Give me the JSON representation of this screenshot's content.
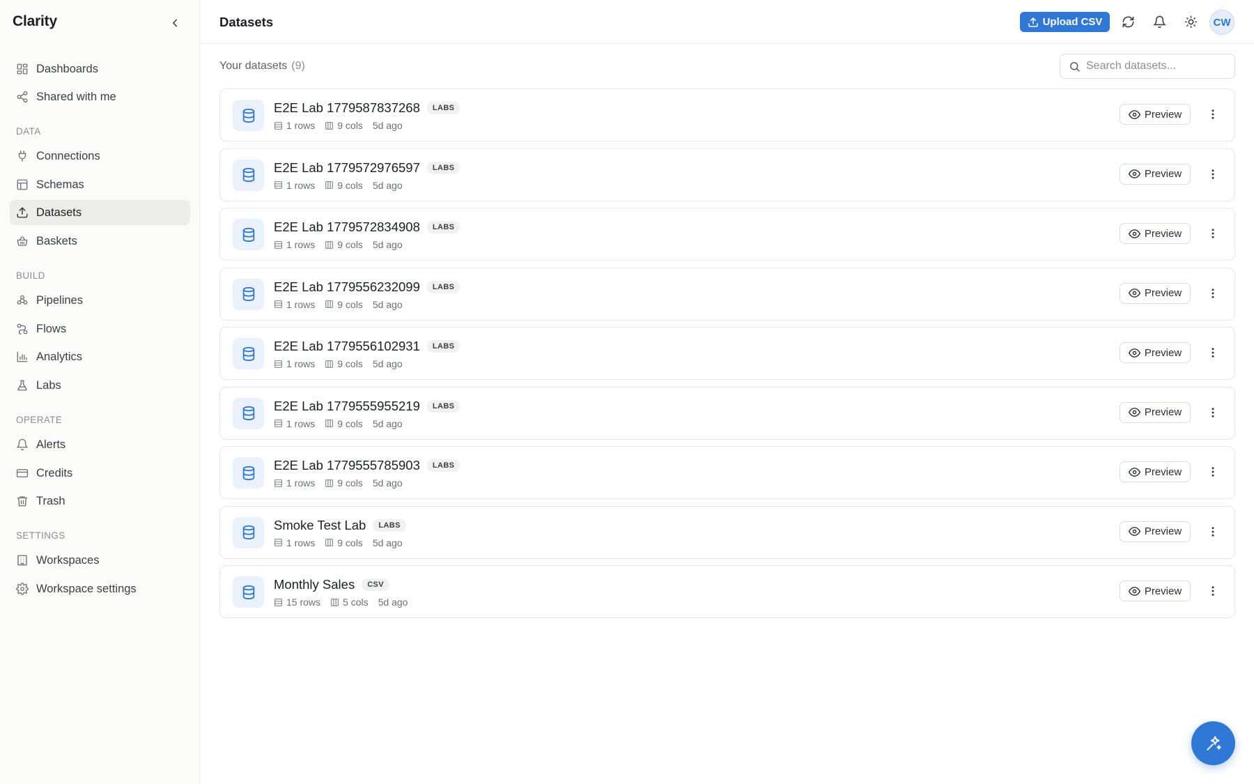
{
  "app": {
    "brand": "Clarity"
  },
  "sidebar": {
    "items_top": [
      {
        "label": "Dashboards",
        "icon": "dashboard-icon"
      },
      {
        "label": "Shared with me",
        "icon": "share-icon"
      }
    ],
    "sections": [
      {
        "label": "DATA",
        "items": [
          {
            "label": "Connections",
            "icon": "plug-icon"
          },
          {
            "label": "Schemas",
            "icon": "table-icon"
          },
          {
            "label": "Datasets",
            "icon": "upload-icon",
            "active": true
          },
          {
            "label": "Baskets",
            "icon": "basket-icon"
          }
        ]
      },
      {
        "label": "BUILD",
        "items": [
          {
            "label": "Pipelines",
            "icon": "pipelines-icon"
          },
          {
            "label": "Flows",
            "icon": "flows-icon"
          },
          {
            "label": "Analytics",
            "icon": "bar-chart-icon"
          },
          {
            "label": "Labs",
            "icon": "flask-icon"
          }
        ]
      },
      {
        "label": "OPERATE",
        "items": [
          {
            "label": "Alerts",
            "icon": "bell-icon"
          },
          {
            "label": "Credits",
            "icon": "credit-card-icon"
          },
          {
            "label": "Trash",
            "icon": "trash-icon"
          }
        ]
      },
      {
        "label": "SETTINGS",
        "items": [
          {
            "label": "Workspaces",
            "icon": "building-icon"
          },
          {
            "label": "Workspace settings",
            "icon": "gear-icon"
          }
        ]
      }
    ]
  },
  "header": {
    "title": "Datasets",
    "upload_label": "Upload CSV",
    "avatar_initials": "CW"
  },
  "main": {
    "heading": "Your datasets",
    "count": "(9)",
    "search_placeholder": "Search datasets...",
    "preview_label": "Preview",
    "datasets": [
      {
        "name": "E2E Lab 1779587837268",
        "badge": "LABS",
        "rows": "1 rows",
        "cols": "9 cols",
        "age": "5d ago"
      },
      {
        "name": "E2E Lab 1779572976597",
        "badge": "LABS",
        "rows": "1 rows",
        "cols": "9 cols",
        "age": "5d ago"
      },
      {
        "name": "E2E Lab 1779572834908",
        "badge": "LABS",
        "rows": "1 rows",
        "cols": "9 cols",
        "age": "5d ago"
      },
      {
        "name": "E2E Lab 1779556232099",
        "badge": "LABS",
        "rows": "1 rows",
        "cols": "9 cols",
        "age": "5d ago"
      },
      {
        "name": "E2E Lab 1779556102931",
        "badge": "LABS",
        "rows": "1 rows",
        "cols": "9 cols",
        "age": "5d ago"
      },
      {
        "name": "E2E Lab 1779555955219",
        "badge": "LABS",
        "rows": "1 rows",
        "cols": "9 cols",
        "age": "5d ago"
      },
      {
        "name": "E2E Lab 1779555785903",
        "badge": "LABS",
        "rows": "1 rows",
        "cols": "9 cols",
        "age": "5d ago"
      },
      {
        "name": "Smoke Test Lab",
        "badge": "LABS",
        "rows": "1 rows",
        "cols": "9 cols",
        "age": "5d ago"
      },
      {
        "name": "Monthly Sales",
        "badge": "CSV",
        "rows": "15 rows",
        "cols": "5 cols",
        "age": "5d ago"
      }
    ]
  },
  "colors": {
    "accent": "#2f78d6",
    "sidebar_bg": "#fbfbfa",
    "active_bg": "#ececea"
  }
}
